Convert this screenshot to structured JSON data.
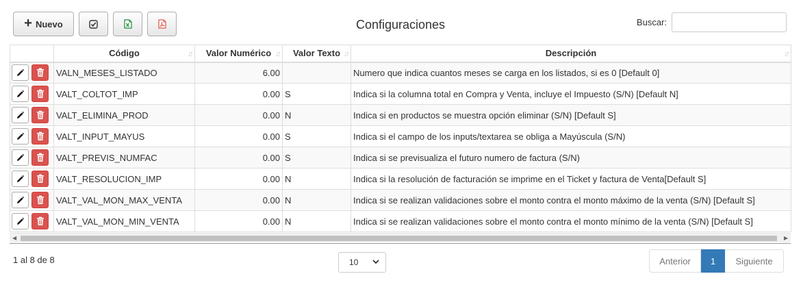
{
  "toolbar": {
    "new_label": "Nuevo",
    "icons": [
      "plus-icon",
      "check-square-icon",
      "excel-icon",
      "pdf-icon"
    ],
    "colors": {
      "excel": "#1e8a3a",
      "pdf": "#d9534f"
    }
  },
  "title": "Configuraciones",
  "search": {
    "label": "Buscar:",
    "value": ""
  },
  "table": {
    "headers": [
      "",
      "Código",
      "Valor Numérico",
      "Valor Texto",
      "Descripción"
    ],
    "rows": [
      {
        "code": "VALN_MESES_LISTADO",
        "num": "6.00",
        "text": "",
        "desc": "Numero que indica cuantos meses se carga en los listados, si es 0 [Default 0]"
      },
      {
        "code": "VALT_COLTOT_IMP",
        "num": "0.00",
        "text": "S",
        "desc": "Indica si la columna total en Compra y Venta, incluye el Impuesto (S/N) [Default N]"
      },
      {
        "code": "VALT_ELIMINA_PROD",
        "num": "0.00",
        "text": "N",
        "desc": "Indica si en productos se muestra opción eliminar (S/N) [Default S]"
      },
      {
        "code": "VALT_INPUT_MAYUS",
        "num": "0.00",
        "text": "S",
        "desc": "Indica si el campo de los inputs/textarea se obliga a Mayúscula (S/N)"
      },
      {
        "code": "VALT_PREVIS_NUMFAC",
        "num": "0.00",
        "text": "S",
        "desc": "Indica si se previsualiza el futuro numero de factura (S/N)"
      },
      {
        "code": "VALT_RESOLUCION_IMP",
        "num": "0.00",
        "text": "N",
        "desc": "Indica si la resolución de facturación se imprime en el Ticket y factura de Venta[Default S]"
      },
      {
        "code": "VALT_VAL_MON_MAX_VENTA",
        "num": "0.00",
        "text": "N",
        "desc": "Indica si se realizan validaciones sobre el monto contra el monto máximo de la venta (S/N) [Default S]"
      },
      {
        "code": "VALT_VAL_MON_MIN_VENTA",
        "num": "0.00",
        "text": "N",
        "desc": "Indica si se realizan validaciones sobre el monto contra el monto mínimo de la venta (S/N) [Default S]"
      }
    ]
  },
  "footer": {
    "info": "1 al 8 de 8",
    "page_size": "10",
    "prev_label": "Anterior",
    "current_page": "1",
    "next_label": "Siguiente"
  }
}
